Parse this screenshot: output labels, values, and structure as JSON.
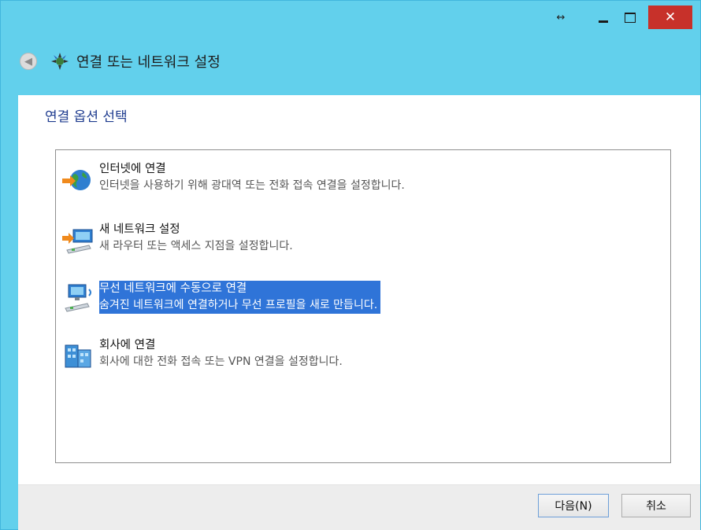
{
  "window": {
    "title": "연결 또는 네트워크 설정",
    "caption_extra": "↔",
    "close_glyph": "✕"
  },
  "page": {
    "heading": "연결 옵션 선택"
  },
  "options": [
    {
      "title": "인터넷에 연결",
      "description": "인터넷을 사용하기 위해 광대역 또는 전화 접속 연결을 설정합니다.",
      "icon": "internet-globe-icon",
      "selected": false
    },
    {
      "title": "새 네트워크 설정",
      "description": "새 라우터 또는 액세스 지점을 설정합니다.",
      "icon": "router-setup-icon",
      "selected": false
    },
    {
      "title": "무선 네트워크에 수동으로 연결",
      "description": "숨겨진 네트워크에 연결하거나 무선 프로필을 새로 만듭니다.",
      "icon": "wireless-network-icon",
      "selected": true
    },
    {
      "title": "회사에 연결",
      "description": "회사에 대한 전화 접속 또는 VPN 연결을 설정합니다.",
      "icon": "workplace-vpn-icon",
      "selected": false
    }
  ],
  "buttons": {
    "next": "다음(N)",
    "cancel": "취소"
  },
  "colors": {
    "titlebar": "#62d0ec",
    "close": "#c7312a",
    "selection": "#2f74d8",
    "heading": "#1f3c8f"
  }
}
